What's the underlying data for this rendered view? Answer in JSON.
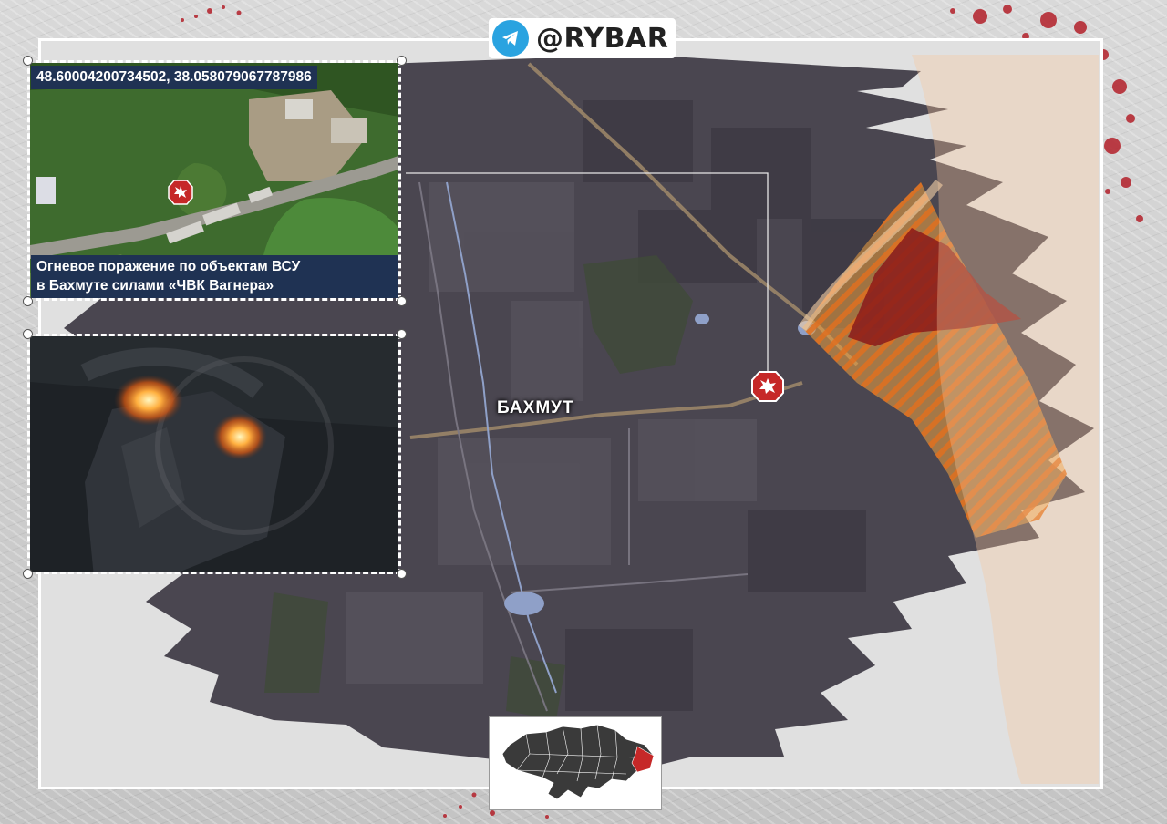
{
  "brand": {
    "handle": "@RYBAR",
    "icon": "telegram-icon",
    "accent_color": "#2aa3e0"
  },
  "inset_satellite": {
    "coordinates": "48.60004200734502, 38.058079067787986",
    "caption_line1": "Огневое поражение по объектам ВСУ",
    "caption_line2": "в Бахмуте силами «ЧВК Вагнера»",
    "caption_bg_color": "#1f3253",
    "marker_icon": "explosion-icon"
  },
  "inset_video": {
    "description_icon": "fire-icon"
  },
  "map": {
    "city_label": "БАХМУТ",
    "strike_marker_icon": "explosion-icon",
    "marker_color": "#c62828",
    "front_zone_color": "#f08c1e",
    "enemy_zone_color": "#8b1a1a"
  },
  "mini_map": {
    "country_icon": "ukraine-map-icon",
    "highlight_color": "#c62828"
  }
}
